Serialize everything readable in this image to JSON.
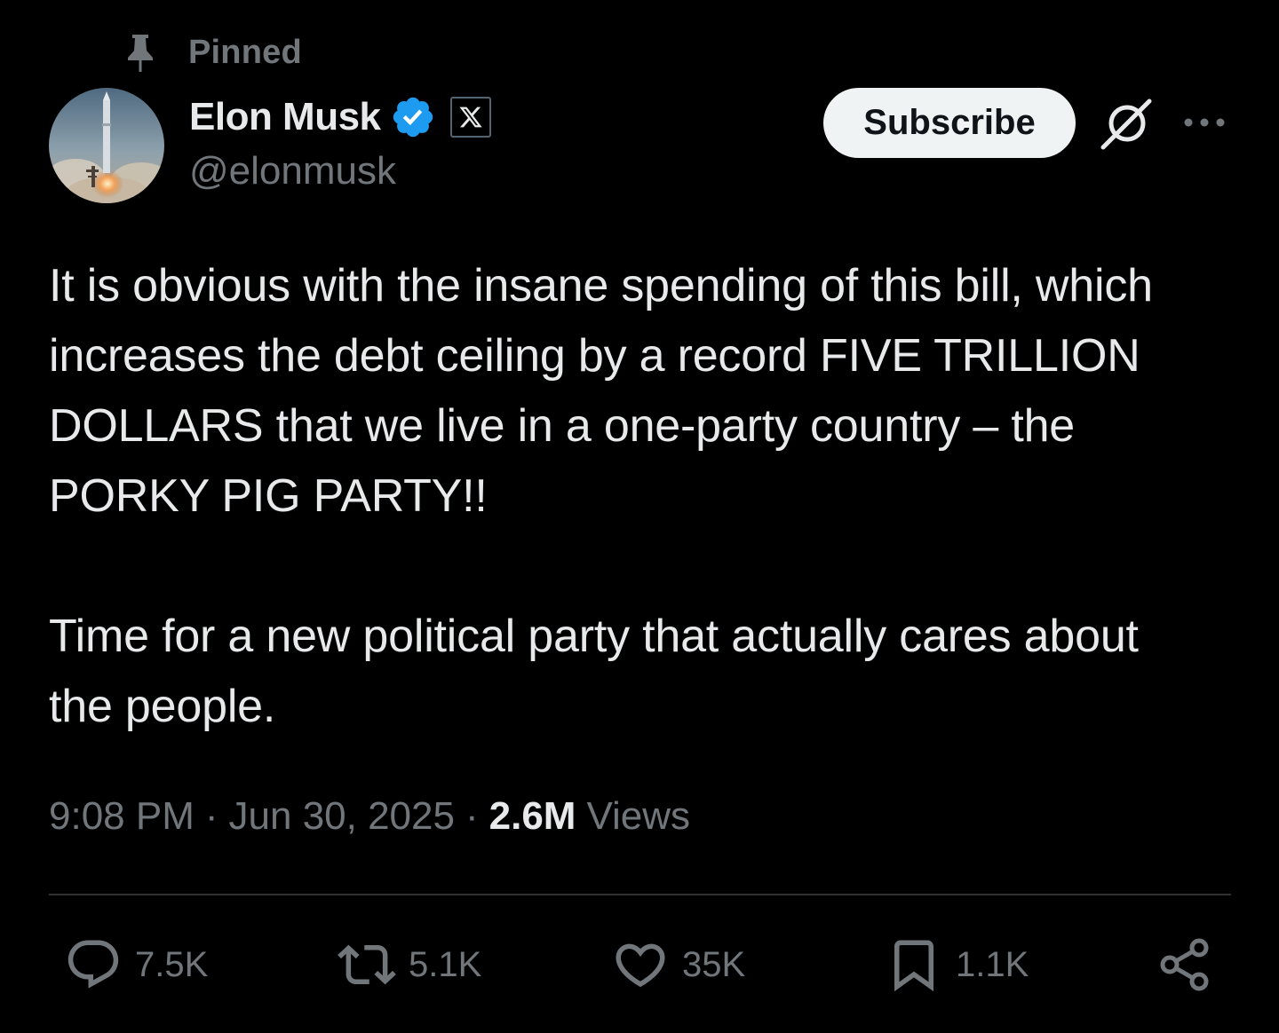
{
  "pinned": {
    "label": "Pinned",
    "icon": "pin-icon"
  },
  "author": {
    "display_name": "Elon Musk",
    "handle": "@elonmusk",
    "verified_icon": "verified-badge-icon",
    "affiliate_icon": "x-logo-icon",
    "avatar": "rocket-launch-avatar"
  },
  "header_actions": {
    "subscribe_label": "Subscribe",
    "grok_icon": "grok-icon",
    "more_icon": "more-icon"
  },
  "tweet": {
    "text": "It is obvious with the insane spending of this bill, which\nincreases the debt ceiling by a record FIVE TRILLION\nDOLLARS that we live in a one-party country – the\nPORKY PIG PARTY!!\n\nTime for a new political party that actually cares about\nthe people."
  },
  "meta": {
    "time": "9:08 PM",
    "separator": "·",
    "date": "Jun 30, 2025",
    "views_count": "2.6M",
    "views_label": "Views"
  },
  "actions": {
    "replies": {
      "count": "7.5K",
      "icon": "reply-icon"
    },
    "reposts": {
      "count": "5.1K",
      "icon": "repost-icon"
    },
    "likes": {
      "count": "35K",
      "icon": "like-icon"
    },
    "bookmarks": {
      "count": "1.1K",
      "icon": "bookmark-icon"
    },
    "share": {
      "icon": "share-icon"
    }
  },
  "colors": {
    "background": "#000000",
    "primary_text": "#e7e9ea",
    "secondary_text": "#71767b",
    "verified_blue": "#1d9bf0",
    "divider": "#2f3336",
    "subscribe_bg": "#eff3f4"
  }
}
